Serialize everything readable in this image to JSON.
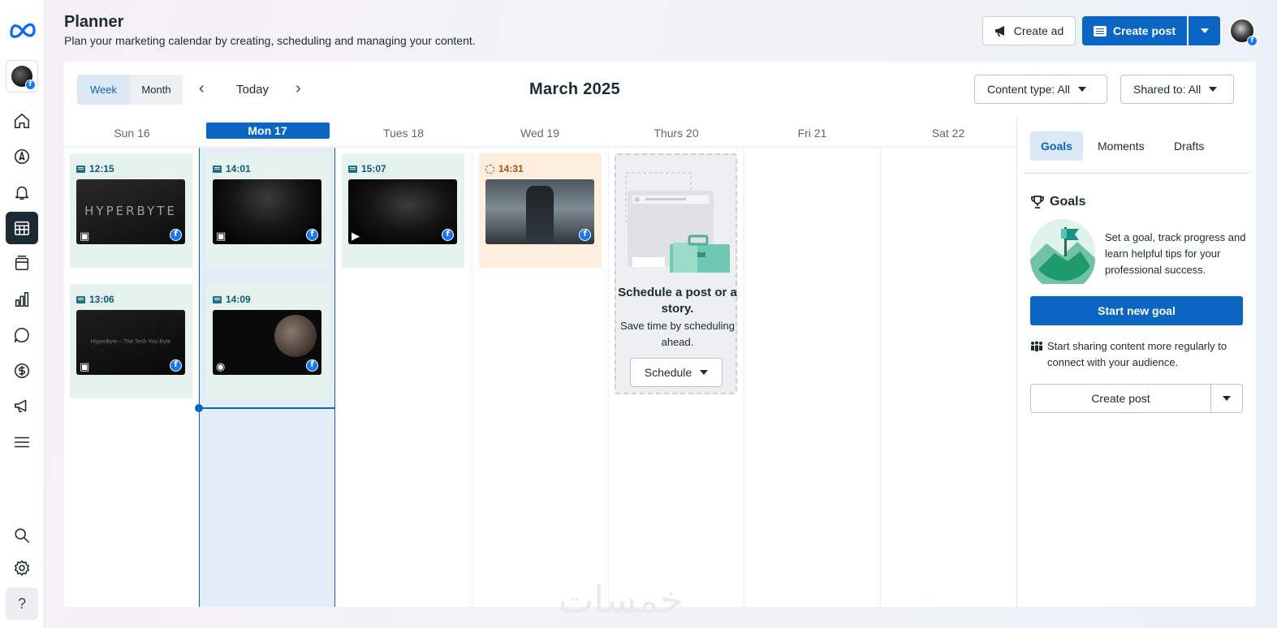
{
  "header": {
    "title": "Planner",
    "subtitle": "Plan your marketing calendar by creating, scheduling and managing your content.",
    "create_ad_label": "Create ad",
    "create_post_label": "Create post"
  },
  "rail": {
    "items": [
      "home-icon",
      "compass-icon",
      "bell-icon",
      "calendar-icon",
      "content-icon",
      "insights-icon",
      "inbox-icon",
      "monetization-icon",
      "ads-icon",
      "menu-icon"
    ],
    "active": "calendar-icon",
    "help_label": "?"
  },
  "toolbar": {
    "week_label": "Week",
    "month_label": "Month",
    "today_label": "Today",
    "current_month": "March 2025",
    "content_type": "Content type: All",
    "shared_to": "Shared to: All"
  },
  "calendar": {
    "days": [
      "Sun 16",
      "Mon 17",
      "Tues 18",
      "Wed 19",
      "Thurs 20",
      "Fri 21",
      "Sat 22"
    ],
    "today_index": 1,
    "posts": [
      {
        "time": "12:15",
        "status": "scheduled",
        "media": "photo",
        "brand": "HYPERBYTE"
      },
      {
        "time": "13:06",
        "status": "scheduled",
        "media": "photo",
        "tagline": "HyperByte – The Tech You Byte"
      },
      {
        "time": "14:01",
        "status": "scheduled",
        "media": "photo"
      },
      {
        "time": "14:09",
        "status": "scheduled",
        "media": "reel"
      },
      {
        "time": "15:07",
        "status": "scheduled",
        "media": "video"
      },
      {
        "time": "14:31",
        "status": "processing",
        "media": "none"
      }
    ],
    "schedule_prompt": {
      "title": "Schedule a post or a story.",
      "text": "Save time by scheduling ahead.",
      "button": "Schedule"
    }
  },
  "panel": {
    "tabs": [
      "Goals",
      "Moments",
      "Drafts"
    ],
    "active_tab": "Goals",
    "goals_heading": "Goals",
    "goals_description": "Set a goal, track progress and learn helpful tips for your professional success.",
    "start_goal_label": "Start new goal",
    "tip": "Start sharing content more regularly to connect with your audience.",
    "create_post_label": "Create post"
  },
  "colors": {
    "accent": "#0a66c2",
    "scheduled_card": "#e6f2ee",
    "processing_card": "#fdeede",
    "today_column": "#e3edf7"
  }
}
